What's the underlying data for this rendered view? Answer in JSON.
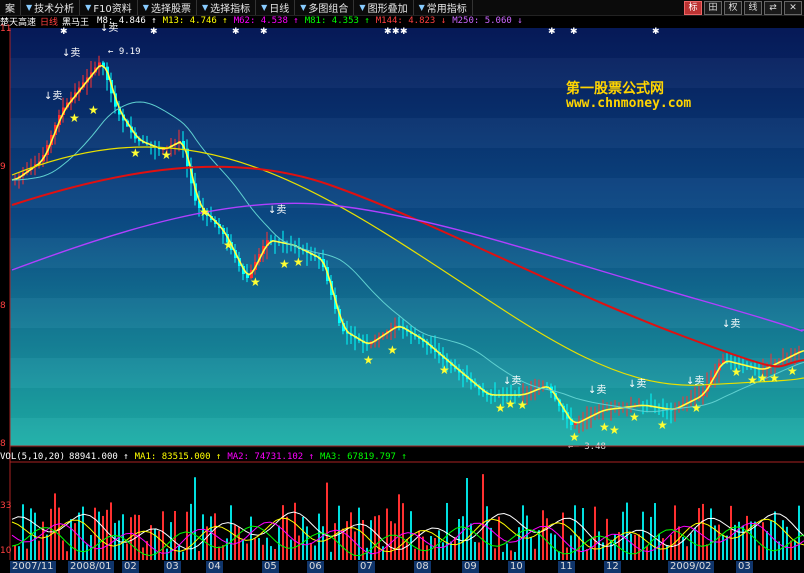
{
  "toolbar": {
    "items": [
      {
        "label": "案",
        "icon": "menu-icon"
      },
      {
        "label": "技术分析",
        "icon": "dropdown-arrow-icon"
      },
      {
        "label": "F10资料",
        "icon": "dropdown-arrow-icon"
      },
      {
        "label": "选择股票",
        "icon": "dropdown-arrow-icon"
      },
      {
        "label": "选择指标",
        "icon": "dropdown-arrow-icon"
      },
      {
        "label": "日线",
        "icon": "dropdown-arrow-icon"
      },
      {
        "label": "多图组合",
        "icon": "dropdown-arrow-icon"
      },
      {
        "label": "图形叠加",
        "icon": "dropdown-arrow-icon"
      },
      {
        "label": "常用指标",
        "icon": "dropdown-arrow-icon"
      }
    ],
    "right_buttons": [
      "标",
      "田",
      "权",
      "线",
      "⇄",
      "✕"
    ]
  },
  "price_info": {
    "stock_name": "楚天高速",
    "period": "日线",
    "indicator": "黑马王",
    "items": [
      {
        "label": "M8:",
        "value": "4.846",
        "arrow": "↑",
        "color": "#ffffff"
      },
      {
        "label": "M13:",
        "value": "4.746",
        "arrow": "↑",
        "color": "#ffff00"
      },
      {
        "label": "M62:",
        "value": "4.538",
        "arrow": "↑",
        "color": "#ff00ff"
      },
      {
        "label": "M81:",
        "value": "4.353",
        "arrow": "↑",
        "color": "#00ff00"
      },
      {
        "label": "M144:",
        "value": "4.823",
        "arrow": "↓",
        "color": "#ff4040"
      },
      {
        "label": "M250:",
        "value": "5.060",
        "arrow": "↓",
        "color": "#cc66ff"
      }
    ]
  },
  "price_axis": {
    "labels": [
      "11",
      "9",
      "8",
      "8"
    ]
  },
  "annotations": {
    "sell_label": "↓卖",
    "high_price": "9.19",
    "low_price": "3.48"
  },
  "watermark": {
    "line1": "第一股票公式网",
    "line2": "www.chnmoney.com"
  },
  "volume_info": {
    "label": "VOL(5,10,20)",
    "items": [
      {
        "label": "",
        "value": "88941.000",
        "arrow": "↑",
        "color": "#ffffff"
      },
      {
        "label": "MA1:",
        "value": "83515.000",
        "arrow": "↑",
        "color": "#ffff00"
      },
      {
        "label": "MA2:",
        "value": "74731.102",
        "arrow": "↑",
        "color": "#ff00ff"
      },
      {
        "label": "MA3:",
        "value": "67819.797",
        "arrow": "↑",
        "color": "#00ff00"
      }
    ]
  },
  "volume_axis": {
    "labels": [
      "33",
      "10"
    ]
  },
  "date_axis": {
    "labels": [
      "2007/11",
      "2008/01",
      "02",
      "03",
      "04",
      "05",
      "06",
      "07",
      "08",
      "09",
      "10",
      "11",
      "12",
      "2009/02",
      "03"
    ]
  },
  "colors": {
    "up": "#ff3030",
    "down": "#00ffff",
    "buy_star": "#ffff33",
    "ma_fast": "#ffffff",
    "ma_yellow": "#e8e000",
    "ma_cyan": "#5fd0d0",
    "ma_red": "#e01010",
    "ma_purple": "#b040ff",
    "panel_bg_top": "#071a5a",
    "panel_bg_bottom": "#1ea9a4"
  }
}
